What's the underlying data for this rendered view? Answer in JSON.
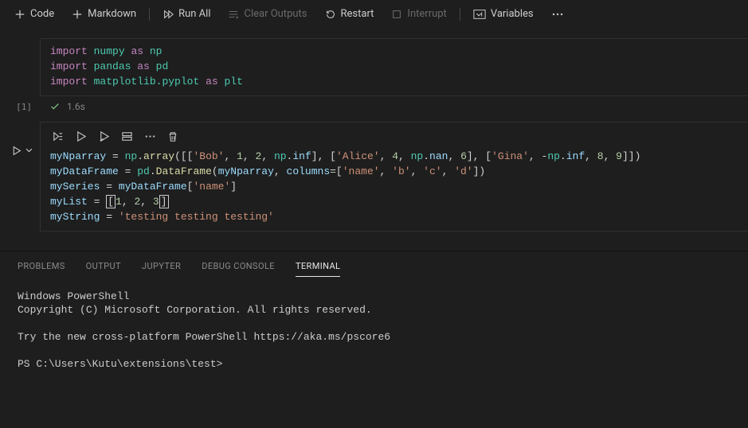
{
  "toolbar": {
    "code_label": "Code",
    "markdown_label": "Markdown",
    "run_all_label": "Run All",
    "clear_outputs_label": "Clear Outputs",
    "restart_label": "Restart",
    "interrupt_label": "Interrupt",
    "variables_label": "Variables"
  },
  "cell1": {
    "exec_count": "[1]",
    "exec_time": "1.6s",
    "line1": {
      "kw1": "import",
      "mod": "numpy",
      "kw2": "as",
      "alias": "np"
    },
    "line2": {
      "kw1": "import",
      "mod": "pandas",
      "kw2": "as",
      "alias": "pd"
    },
    "line3": {
      "kw1": "import",
      "mod": "matplotlib.pyplot",
      "kw2": "as",
      "alias": "plt"
    }
  },
  "cell2": {
    "l1": {
      "v": "myNparray",
      "eq": " = ",
      "np": "np",
      "dot": ".",
      "fn": "array",
      "open": "([[",
      "s1": "'Bob'",
      "c1": ", ",
      "n1": "1",
      "c2": ", ",
      "n2": "2",
      "c3": ", ",
      "np2": "np",
      "dot2": ".",
      "inf1": "inf",
      "mid1": "], [",
      "s2": "'Alice'",
      "c4": ", ",
      "n3": "4",
      "c5": ", ",
      "np3": "np",
      "dot3": ".",
      "nan": "nan",
      "c6": ", ",
      "n4": "6",
      "mid2": "], [",
      "s3": "'Gina'",
      "c7": ", -",
      "np4": "np",
      "dot4": ".",
      "inf2": "inf",
      "c8": ", ",
      "n5": "8",
      "c9": ", ",
      "n6": "9",
      "close": "]])"
    },
    "l2": {
      "v": "myDataFrame",
      "eq": " = ",
      "pd": "pd",
      "dot": ".",
      "fn": "DataFrame",
      "open": "(",
      "arg1": "myNparray",
      "c1": ", ",
      "kw": "columns",
      "eq2": "=[",
      "s1": "'name'",
      "c2": ", ",
      "s2": "'b'",
      "c3": ", ",
      "s3": "'c'",
      "c4": ", ",
      "s4": "'d'",
      "close": "])"
    },
    "l3": {
      "v": "mySeries",
      "eq": " = ",
      "df": "myDataFrame",
      "open": "[",
      "s": "'name'",
      "close": "]"
    },
    "l4": {
      "v": "myList",
      "eq": " = ",
      "open": "[",
      "n1": "1",
      "c1": ", ",
      "n2": "2",
      "c2": ", ",
      "n3": "3",
      "close": "]"
    },
    "l5": {
      "v": "myString",
      "eq": " = ",
      "s": "'testing testing testing'"
    }
  },
  "panel_tabs": {
    "problems": "PROBLEMS",
    "output": "OUTPUT",
    "jupyter": "JUPYTER",
    "debug_console": "DEBUG CONSOLE",
    "terminal": "TERMINAL"
  },
  "terminal": {
    "line1": "Windows PowerShell",
    "line2": "Copyright (C) Microsoft Corporation. All rights reserved.",
    "blank1": "",
    "line3": "Try the new cross-platform PowerShell https://aka.ms/pscore6",
    "blank2": "",
    "prompt": "PS C:\\Users\\Kutu\\extensions\\test>"
  }
}
